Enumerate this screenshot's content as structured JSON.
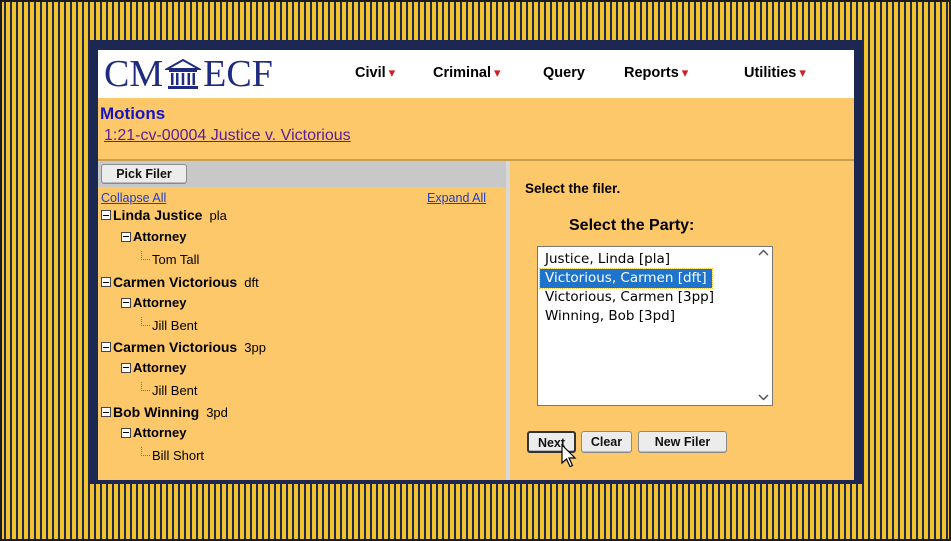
{
  "app": {
    "logo": {
      "left": "CM",
      "right": "ECF"
    },
    "menu": [
      {
        "label": "Civil",
        "id": "civil"
      },
      {
        "label": "Criminal",
        "id": "criminal"
      },
      {
        "label": "Query",
        "id": "query"
      },
      {
        "label": "Reports",
        "id": "reports"
      },
      {
        "label": "Utilities",
        "id": "utilities"
      }
    ],
    "caret": "▾"
  },
  "page": {
    "title": "Motions",
    "case_link": "1:21-cv-00004 Justice v. Victorious"
  },
  "left": {
    "pick_filer": "Pick Filer",
    "collapse_all": "Collapse All",
    "expand_all": "Expand All",
    "parties": [
      {
        "name": "Linda Justice",
        "role": "pla",
        "attorney_label": "Attorney",
        "attorney": "Tom Tall"
      },
      {
        "name": "Carmen Victorious",
        "role": "dft",
        "attorney_label": "Attorney",
        "attorney": "Jill Bent"
      },
      {
        "name": "Carmen Victorious",
        "role": "3pp",
        "attorney_label": "Attorney",
        "attorney": "Jill Bent"
      },
      {
        "name": "Bob Winning",
        "role": "3pd",
        "attorney_label": "Attorney",
        "attorney": "Bill Short"
      }
    ]
  },
  "right": {
    "select_filer": "Select the filer.",
    "select_party": "Select the Party:",
    "options": [
      {
        "label": "Justice, Linda [pla]",
        "selected": false
      },
      {
        "label": "Victorious, Carmen [dft]",
        "selected": true
      },
      {
        "label": "Victorious, Carmen [3pp]",
        "selected": false
      },
      {
        "label": "Winning, Bob [3pd]",
        "selected": false
      }
    ],
    "buttons": {
      "next": "Next",
      "clear": "Clear",
      "new_filer": "New Filer"
    }
  },
  "colors": {
    "panel_bg": "#fdc86a",
    "frame": "#1c2852",
    "logo": "#1e2b80",
    "title": "#1515c8",
    "caret": "#d21f1f",
    "selected": "#1e73cc"
  }
}
